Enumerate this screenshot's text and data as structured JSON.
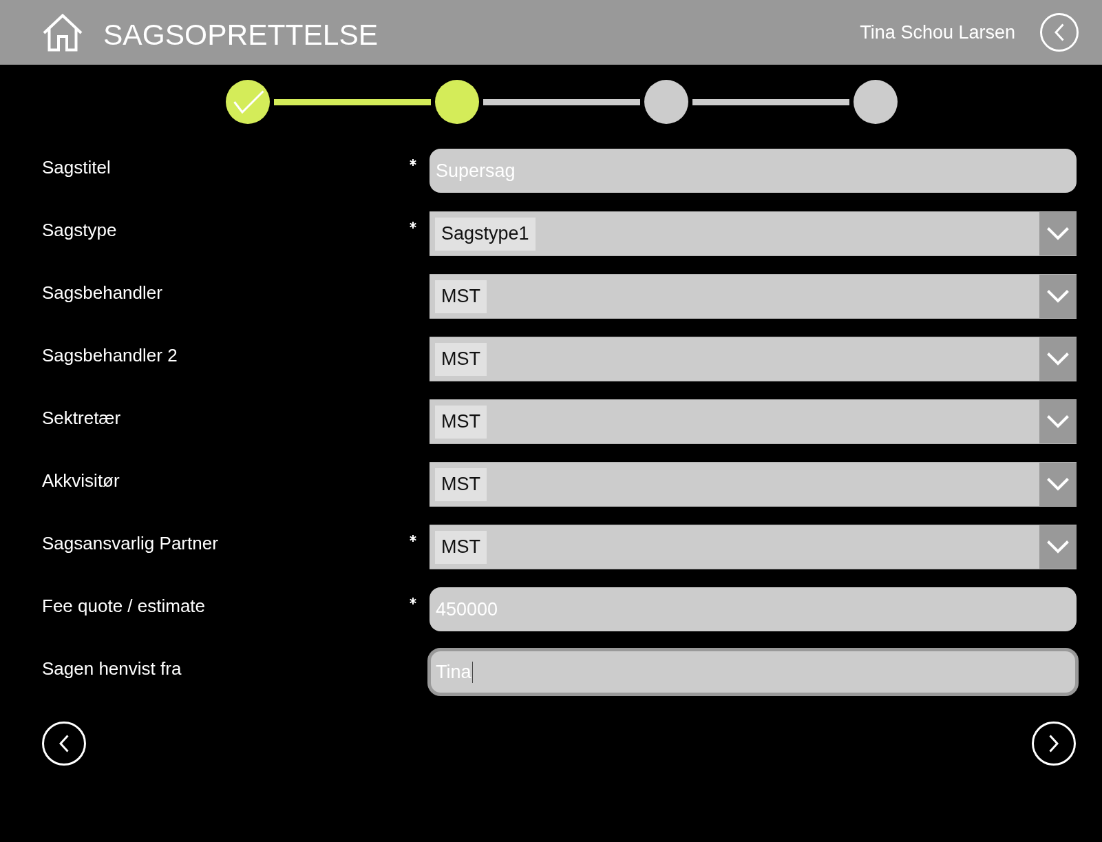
{
  "header": {
    "title": "SAGSOPRETTELSE",
    "user_name": "Tina Schou Larsen"
  },
  "progress_steps": [
    {
      "kind": "done"
    },
    {
      "kind": "current"
    },
    {
      "kind": "todo"
    },
    {
      "kind": "todo"
    }
  ],
  "form_fields": [
    {
      "label": "Sagstitel",
      "required": true,
      "kind": "text",
      "value": "Supersag",
      "focused": false
    },
    {
      "label": "Sagstype",
      "required": true,
      "kind": "select",
      "value": "Sagstype1",
      "focused": false
    },
    {
      "label": "Sagsbehandler",
      "required": false,
      "kind": "select",
      "value": "MST",
      "focused": false
    },
    {
      "label": "Sagsbehandler 2",
      "required": false,
      "kind": "select",
      "value": "MST",
      "focused": false
    },
    {
      "label": "Sektretær",
      "required": false,
      "kind": "select",
      "value": "MST",
      "focused": false
    },
    {
      "label": "Akkvisitør",
      "required": false,
      "kind": "select",
      "value": "MST",
      "focused": false
    },
    {
      "label": "Sagsansvarlig Partner",
      "required": true,
      "kind": "select",
      "value": "MST",
      "focused": false
    },
    {
      "label": "Fee quote / estimate",
      "required": true,
      "kind": "text",
      "value": "450000",
      "focused": false
    },
    {
      "label": "Sagen henvist fra",
      "required": false,
      "kind": "text",
      "value": "Tina",
      "focused": true
    }
  ]
}
